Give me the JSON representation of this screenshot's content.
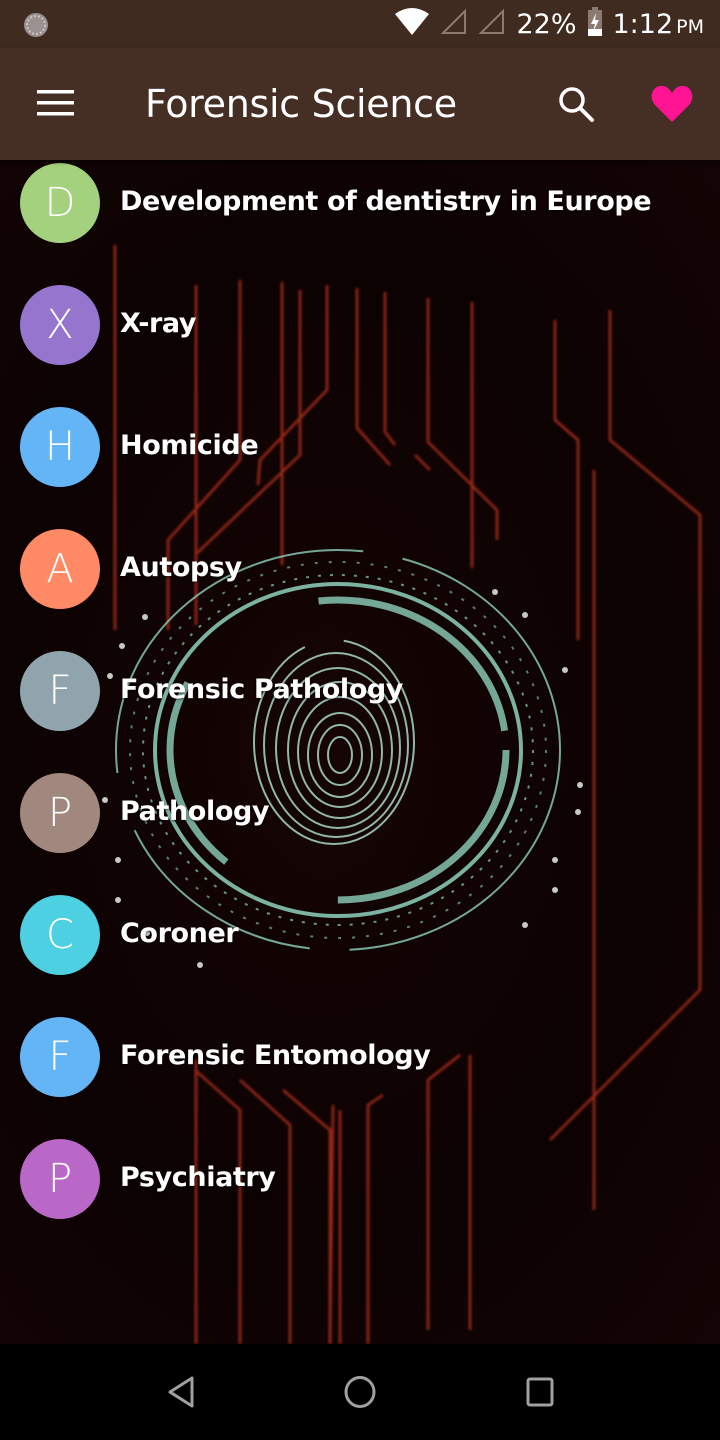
{
  "status_bar": {
    "battery_percent": "22%",
    "time": "1:12",
    "ampm": "PM"
  },
  "app_bar": {
    "title": "Forensic Science",
    "menu_icon": "hamburger-menu-icon",
    "search_icon": "search-icon",
    "favorite_icon": "heart-icon",
    "favorite_color": "#ff1493"
  },
  "topics": [
    {
      "letter": "D",
      "label": "Development of dentistry in Europe",
      "color": "#a3d17e"
    },
    {
      "letter": "X",
      "label": "X-ray",
      "color": "#9575cd"
    },
    {
      "letter": "H",
      "label": "Homicide",
      "color": "#64b5f6"
    },
    {
      "letter": "A",
      "label": "Autopsy",
      "color": "#ff8a65"
    },
    {
      "letter": "F",
      "label": "Forensic Pathology",
      "color": "#90a4ae"
    },
    {
      "letter": "P",
      "label": "Pathology",
      "color": "#a1887f"
    },
    {
      "letter": "C",
      "label": "Coroner",
      "color": "#4dd0e1"
    },
    {
      "letter": "F",
      "label": "Forensic Entomology",
      "color": "#64b5f6"
    },
    {
      "letter": "P",
      "label": "Psychiatry",
      "color": "#ba68c8"
    }
  ],
  "nav_bar": {
    "back_icon": "back-icon",
    "home_icon": "home-icon",
    "recents_icon": "recents-icon"
  }
}
